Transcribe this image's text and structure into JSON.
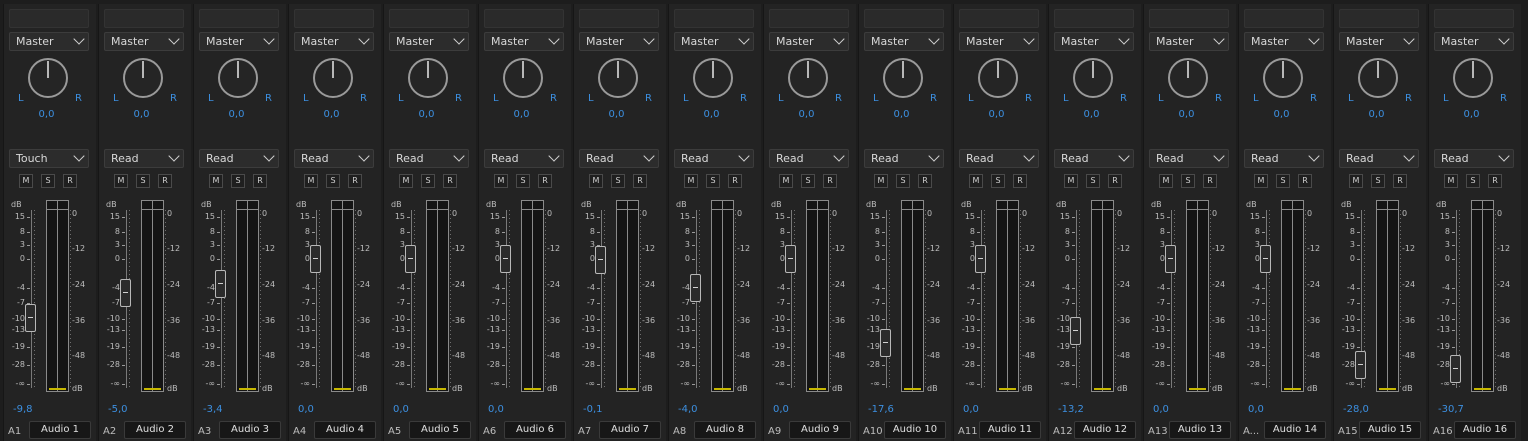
{
  "colors": {
    "accent": "#3c8fe0",
    "meter_floor": "#c7b800",
    "background": "#1d1d1d"
  },
  "labels": {
    "pan_left": "L",
    "pan_right": "R",
    "mute": "M",
    "solo": "S",
    "record": "R",
    "db": "dB"
  },
  "fader_scale": [
    "15",
    "8",
    "3",
    "0",
    "-4",
    "-7",
    "-10",
    "-13",
    "-19",
    "-28",
    "-∞"
  ],
  "meter_scale": [
    "0",
    "-12",
    "-24",
    "-36",
    "-48",
    "dB"
  ],
  "channels": [
    {
      "code": "A1",
      "name": "Audio 1",
      "send": "Master",
      "automation": "Touch",
      "pan": "0,0",
      "volume": "-9,8"
    },
    {
      "code": "A2",
      "name": "Audio 2",
      "send": "Master",
      "automation": "Read",
      "pan": "0,0",
      "volume": "-5,0"
    },
    {
      "code": "A3",
      "name": "Audio 3",
      "send": "Master",
      "automation": "Read",
      "pan": "0,0",
      "volume": "-3,4"
    },
    {
      "code": "A4",
      "name": "Audio 4",
      "send": "Master",
      "automation": "Read",
      "pan": "0,0",
      "volume": "0,0"
    },
    {
      "code": "A5",
      "name": "Audio 5",
      "send": "Master",
      "automation": "Read",
      "pan": "0,0",
      "volume": "0,0"
    },
    {
      "code": "A6",
      "name": "Audio 6",
      "send": "Master",
      "automation": "Read",
      "pan": "0,0",
      "volume": "0,0"
    },
    {
      "code": "A7",
      "name": "Audio 7",
      "send": "Master",
      "automation": "Read",
      "pan": "0,0",
      "volume": "-0,1"
    },
    {
      "code": "A8",
      "name": "Audio 8",
      "send": "Master",
      "automation": "Read",
      "pan": "0,0",
      "volume": "-4,0"
    },
    {
      "code": "A9",
      "name": "Audio 9",
      "send": "Master",
      "automation": "Read",
      "pan": "0,0",
      "volume": "0,0"
    },
    {
      "code": "A10",
      "name": "Audio 10",
      "send": "Master",
      "automation": "Read",
      "pan": "0,0",
      "volume": "-17,6"
    },
    {
      "code": "A11",
      "name": "Audio 11",
      "send": "Master",
      "automation": "Read",
      "pan": "0,0",
      "volume": "0,0"
    },
    {
      "code": "A12",
      "name": "Audio 12",
      "send": "Master",
      "automation": "Read",
      "pan": "0,0",
      "volume": "-13,2"
    },
    {
      "code": "A13",
      "name": "Audio 13",
      "send": "Master",
      "automation": "Read",
      "pan": "0,0",
      "volume": "0,0"
    },
    {
      "code": "A...",
      "name": "Audio 14",
      "send": "Master",
      "automation": "Read",
      "pan": "0,0",
      "volume": "0,0"
    },
    {
      "code": "A15",
      "name": "Audio 15",
      "send": "Master",
      "automation": "Read",
      "pan": "0,0",
      "volume": "-28,0"
    },
    {
      "code": "A16",
      "name": "Audio 16",
      "send": "Master",
      "automation": "Read",
      "pan": "0,0",
      "volume": "-30,7"
    }
  ]
}
